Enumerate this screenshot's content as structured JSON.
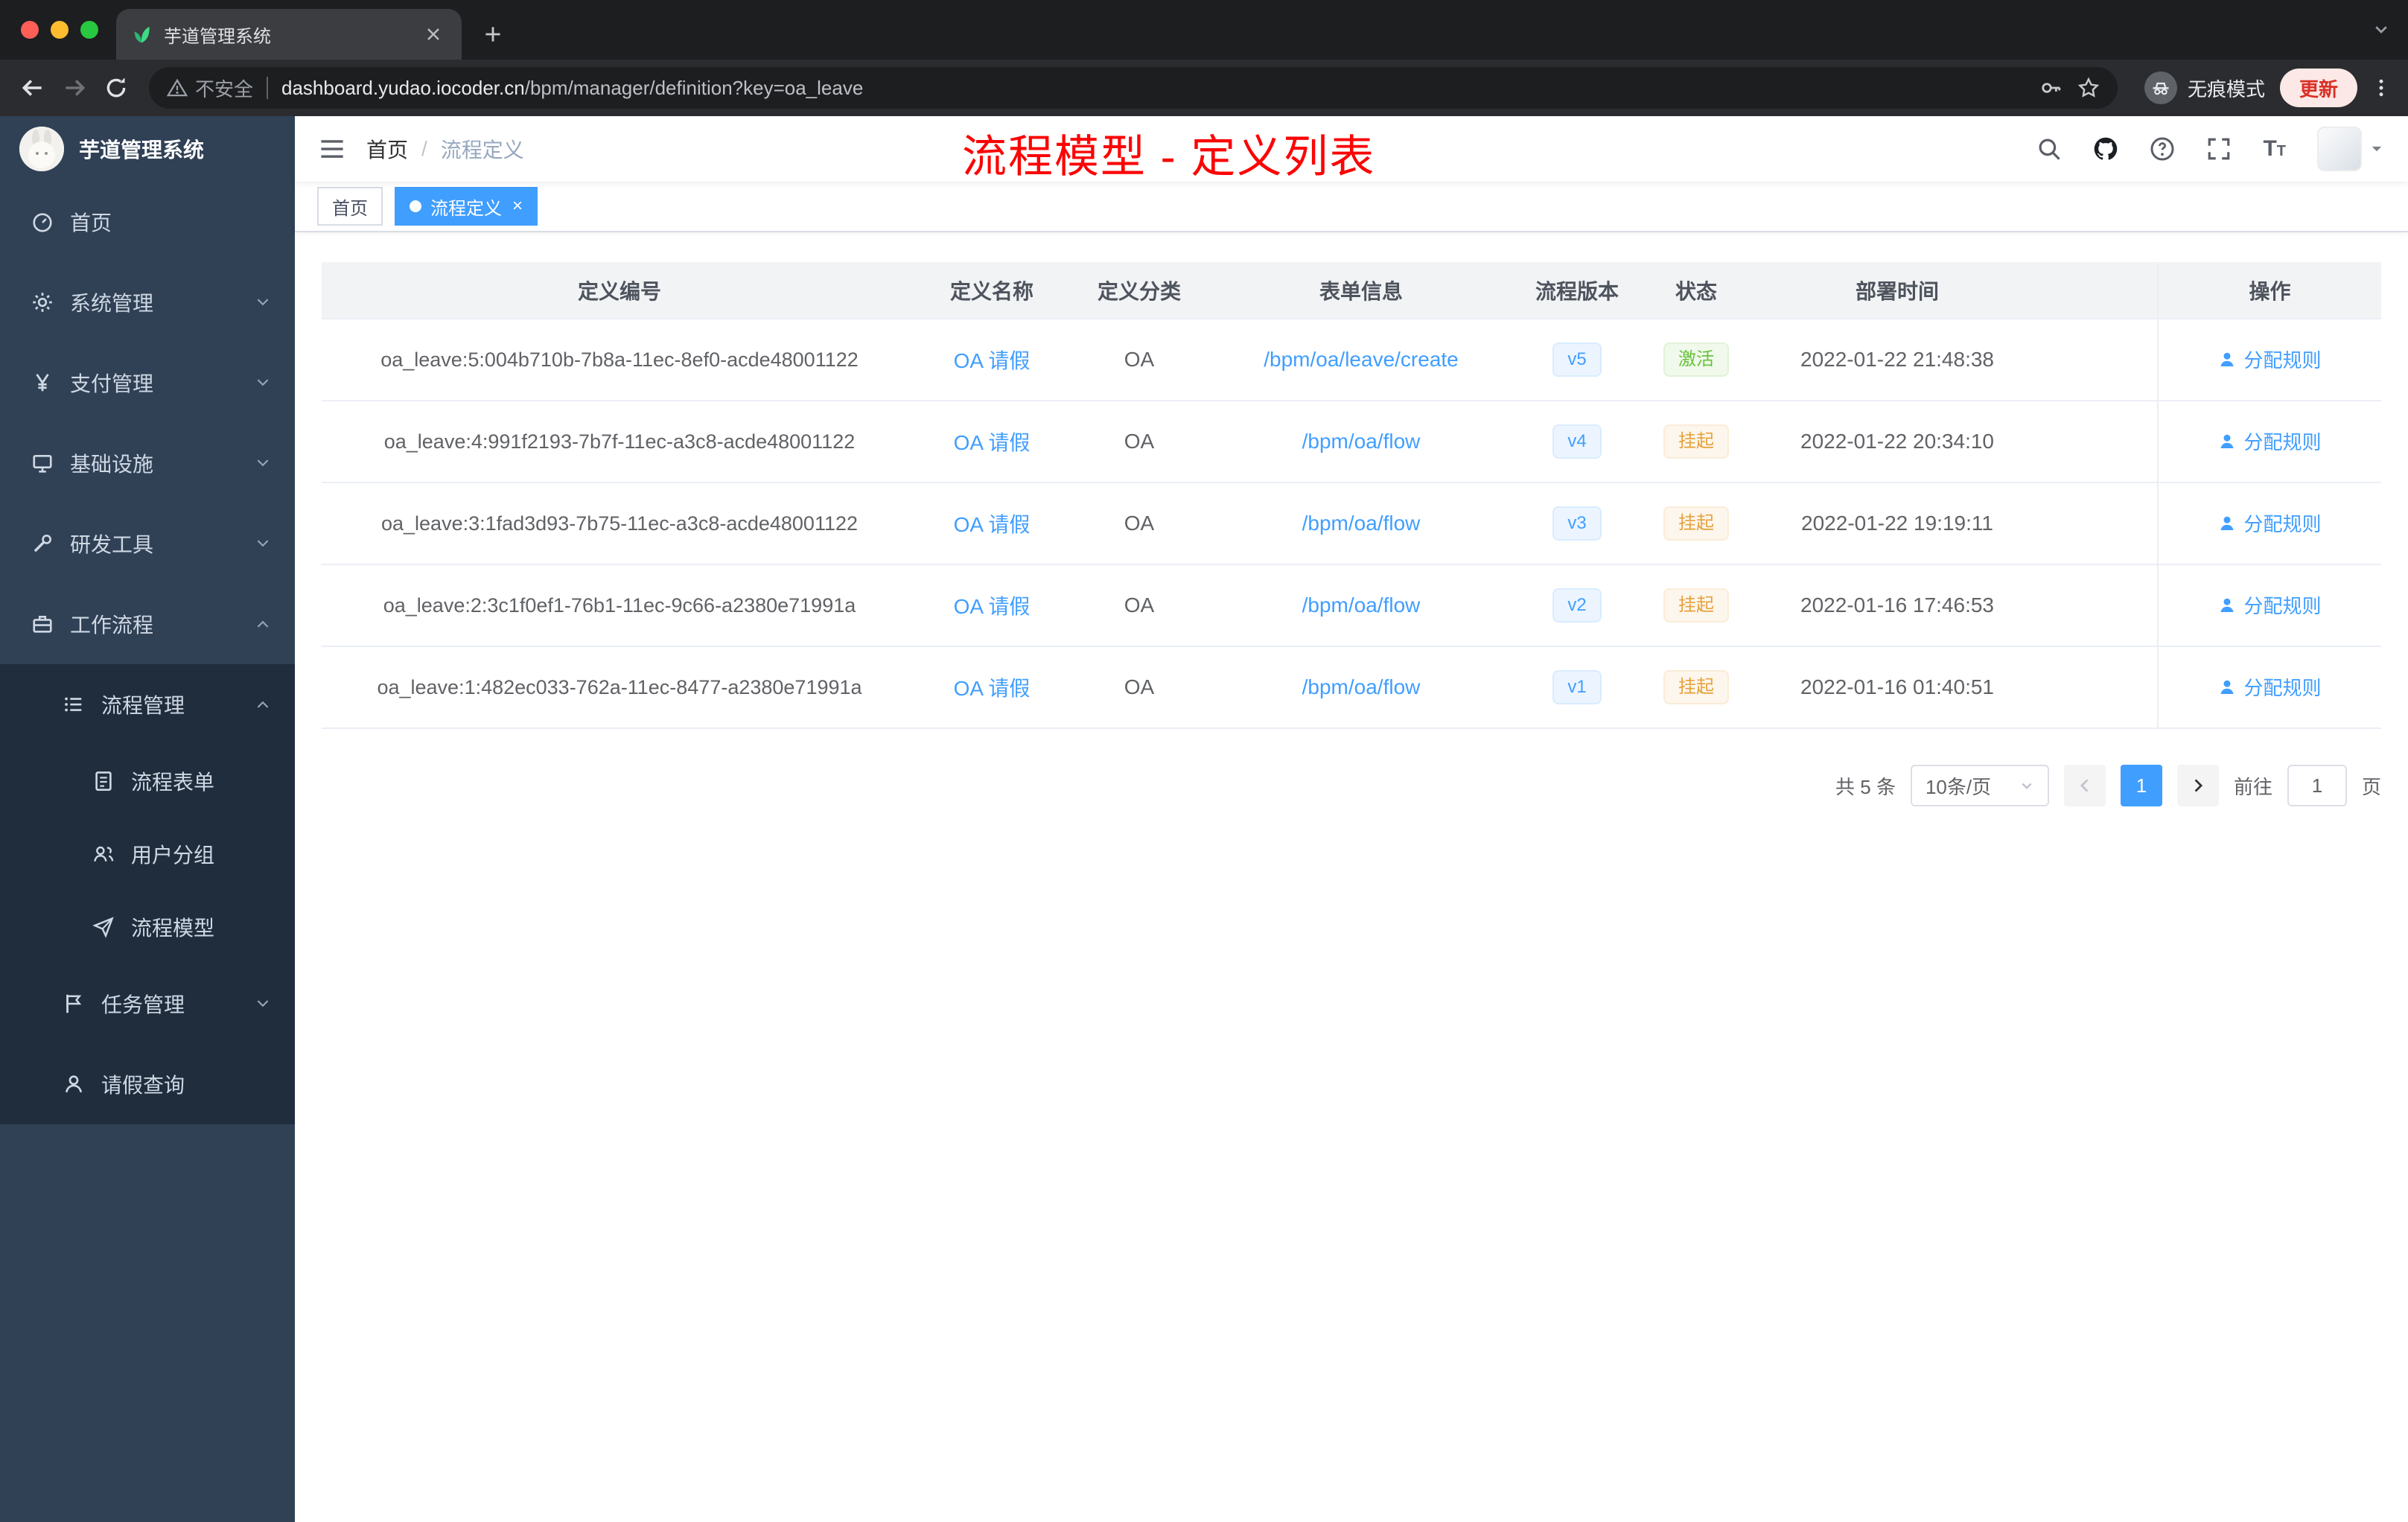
{
  "browser": {
    "tab_title": "芋道管理系统",
    "security_label": "不安全",
    "url_host": "dashboard.yudao.iocoder.cn",
    "url_path": "/bpm/manager/definition?key=oa_leave",
    "incognito_label": "无痕模式",
    "update_label": "更新"
  },
  "sidebar": {
    "logo_title": "芋道管理系统",
    "items": [
      {
        "key": "home",
        "label": "首页",
        "icon": "dashboard-icon",
        "level": 1
      },
      {
        "key": "system",
        "label": "系统管理",
        "icon": "gear-icon",
        "level": 1,
        "chevron": "down"
      },
      {
        "key": "payment",
        "label": "支付管理",
        "icon": "yen-icon",
        "level": 1,
        "chevron": "down"
      },
      {
        "key": "infra",
        "label": "基础设施",
        "icon": "monitor-icon",
        "level": 1,
        "chevron": "down"
      },
      {
        "key": "devtools",
        "label": "研发工具",
        "icon": "tool-icon",
        "level": 1,
        "chevron": "down"
      },
      {
        "key": "workflow",
        "label": "工作流程",
        "icon": "briefcase-icon",
        "level": 1,
        "chevron": "up"
      },
      {
        "key": "process-mgmt",
        "label": "流程管理",
        "icon": "list-icon",
        "level": 2,
        "chevron": "up"
      },
      {
        "key": "process-form",
        "label": "流程表单",
        "icon": "document-icon",
        "level": 3
      },
      {
        "key": "user-group",
        "label": "用户分组",
        "icon": "people-icon",
        "level": 3
      },
      {
        "key": "process-model",
        "label": "流程模型",
        "icon": "send-icon",
        "level": 3
      },
      {
        "key": "task-mgmt",
        "label": "任务管理",
        "icon": "flag-icon",
        "level": 2,
        "chevron": "down"
      },
      {
        "key": "leave-query",
        "label": "请假查询",
        "icon": "user-icon",
        "level": 2
      }
    ]
  },
  "navbar": {
    "breadcrumb": [
      "首页",
      "流程定义"
    ],
    "annotation": "流程模型 - 定义列表"
  },
  "tags": [
    {
      "label": "首页",
      "active": false,
      "closable": false
    },
    {
      "label": "流程定义",
      "active": true,
      "closable": true
    }
  ],
  "table": {
    "columns": [
      "定义编号",
      "定义名称",
      "定义分类",
      "表单信息",
      "流程版本",
      "状态",
      "部署时间",
      "操作"
    ],
    "rows": [
      {
        "id": "oa_leave:5:004b710b-7b8a-11ec-8ef0-acde48001122",
        "name": "OA 请假",
        "category": "OA",
        "form": "/bpm/oa/leave/create",
        "version": "v5",
        "status": "激活",
        "status_type": "success",
        "time": "2022-01-22 21:48:38",
        "action": "分配规则"
      },
      {
        "id": "oa_leave:4:991f2193-7b7f-11ec-a3c8-acde48001122",
        "name": "OA 请假",
        "category": "OA",
        "form": "/bpm/oa/flow",
        "version": "v4",
        "status": "挂起",
        "status_type": "warning",
        "time": "2022-01-22 20:34:10",
        "action": "分配规则"
      },
      {
        "id": "oa_leave:3:1fad3d93-7b75-11ec-a3c8-acde48001122",
        "name": "OA 请假",
        "category": "OA",
        "form": "/bpm/oa/flow",
        "version": "v3",
        "status": "挂起",
        "status_type": "warning",
        "time": "2022-01-22 19:19:11",
        "action": "分配规则"
      },
      {
        "id": "oa_leave:2:3c1f0ef1-76b1-11ec-9c66-a2380e71991a",
        "name": "OA 请假",
        "category": "OA",
        "form": "/bpm/oa/flow",
        "version": "v2",
        "status": "挂起",
        "status_type": "warning",
        "time": "2022-01-16 17:46:53",
        "action": "分配规则"
      },
      {
        "id": "oa_leave:1:482ec033-762a-11ec-8477-a2380e71991a",
        "name": "OA 请假",
        "category": "OA",
        "form": "/bpm/oa/flow",
        "version": "v1",
        "status": "挂起",
        "status_type": "warning",
        "time": "2022-01-16 01:40:51",
        "action": "分配规则"
      }
    ]
  },
  "pagination": {
    "total": "共 5 条",
    "page_size": "10条/页",
    "current": "1",
    "goto_label": "前往",
    "goto_value": "1",
    "page_label": "页"
  },
  "colors": {
    "accent": "#409eff",
    "success": "#67c23a",
    "warning": "#e6a23c",
    "annotation_red": "#fb0505",
    "sidebar_bg": "#304156",
    "submenu_bg": "#1f2d3d"
  }
}
